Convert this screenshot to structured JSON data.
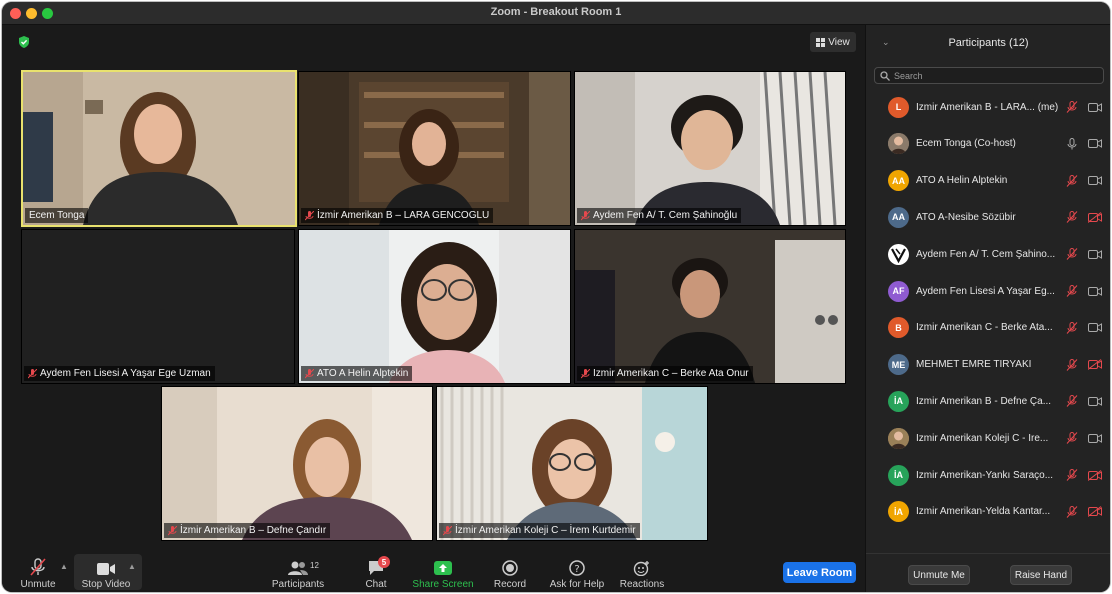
{
  "window": {
    "title": "Zoom - Breakout Room 1"
  },
  "view_button": {
    "label": "View"
  },
  "tiles": [
    {
      "name": "Ecem Tonga",
      "muted": false,
      "active": true
    },
    {
      "name": "İzmir Amerikan B – LARA GENCOGLU",
      "muted": true
    },
    {
      "name": "Aydem Fen A/ T. Cem Şahinoğlu",
      "muted": true
    },
    {
      "name": "Aydem Fen Lisesi A Yaşar Ege Uzman",
      "muted": true,
      "video_off": true
    },
    {
      "name": "ATO A Helin Alptekin",
      "muted": true
    },
    {
      "name": "Izmir Amerikan C – Berke Ata Onur",
      "muted": true
    },
    {
      "name": "İzmir Amerikan B – Defne Çandır",
      "muted": true
    },
    {
      "name": "İzmir Amerikan Koleji C – İrem Kurtdemir",
      "muted": true
    }
  ],
  "toolbar": {
    "unmute_label": "Unmute",
    "stop_video_label": "Stop Video",
    "participants_label": "Participants",
    "participants_count": "12",
    "chat_label": "Chat",
    "chat_badge": "5",
    "share_label": "Share Screen",
    "record_label": "Record",
    "help_label": "Ask for Help",
    "reactions_label": "Reactions",
    "leave_label": "Leave Room"
  },
  "panel": {
    "title": "Participants (12)",
    "search_placeholder": "Search",
    "unmute_me_label": "Unmute Me",
    "raise_hand_label": "Raise Hand",
    "participants": [
      {
        "initials": "L",
        "color": "#e05a2b",
        "name": "İzmir Amerikan B - LARA... (me)",
        "mic": "muted",
        "cam": "on"
      },
      {
        "initials": "",
        "color": "#8a7a6a",
        "name": "Ecem Tonga (Co-host)",
        "mic": "on",
        "cam": "on",
        "photo": true
      },
      {
        "initials": "AA",
        "color": "#f0a500",
        "name": "ATO A Helin Alptekin",
        "mic": "muted",
        "cam": "on"
      },
      {
        "initials": "AA",
        "color": "#4d6a8a",
        "name": "ATO A-Nesibe Sözübir",
        "mic": "muted",
        "cam": "off"
      },
      {
        "initials": "",
        "color": "#ffffff",
        "name": "Aydem Fen A/ T. Cem Şahino...",
        "mic": "muted",
        "cam": "on",
        "logo": true
      },
      {
        "initials": "AF",
        "color": "#8f5bd1",
        "name": "Aydem Fen Lisesi A Yaşar Eg...",
        "mic": "muted",
        "cam": "on"
      },
      {
        "initials": "B",
        "color": "#e05a2b",
        "name": "Izmir Amerikan C - Berke Ata...",
        "mic": "muted",
        "cam": "on"
      },
      {
        "initials": "ME",
        "color": "#4d6a8a",
        "name": "MEHMET EMRE TİRYAKİ",
        "mic": "muted",
        "cam": "off"
      },
      {
        "initials": "İA",
        "color": "#27a35a",
        "name": "İzmir Amerikan B - Defne Ça...",
        "mic": "muted",
        "cam": "on"
      },
      {
        "initials": "",
        "color": "#9a8058",
        "name": "İzmir Amerikan Koleji C - İre...",
        "mic": "muted",
        "cam": "on",
        "photo": true
      },
      {
        "initials": "İA",
        "color": "#27a35a",
        "name": "İzmir Amerikan-Yankı Saraço...",
        "mic": "muted",
        "cam": "off"
      },
      {
        "initials": "İA",
        "color": "#f0a500",
        "name": "İzmir Amerikan-Yelda Kantar...",
        "mic": "muted",
        "cam": "off"
      }
    ]
  }
}
